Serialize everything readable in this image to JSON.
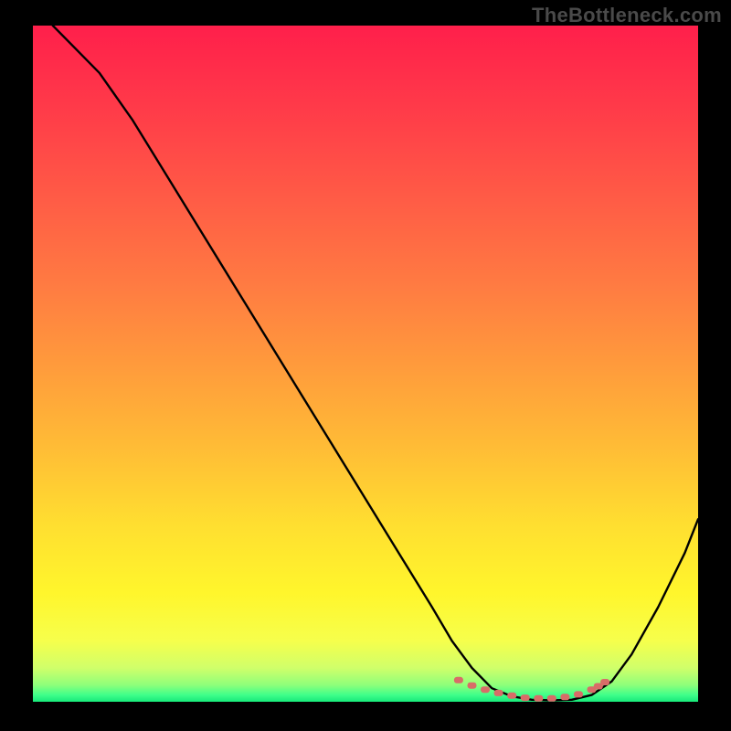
{
  "watermark": "TheBottleneck.com",
  "chart_data": {
    "type": "line",
    "title": "",
    "xlabel": "",
    "ylabel": "",
    "xlim": [
      0,
      100
    ],
    "ylim": [
      0,
      100
    ],
    "grid": false,
    "legend": false,
    "background": "rainbow_vertical",
    "series": [
      {
        "name": "bottleneck-curve",
        "x": [
          3,
          5,
          10,
          15,
          20,
          25,
          30,
          35,
          40,
          45,
          50,
          55,
          60,
          63,
          66,
          69,
          72,
          75,
          78,
          81,
          84,
          87,
          90,
          94,
          98,
          100
        ],
        "y": [
          100,
          98,
          93,
          86,
          78,
          70,
          62,
          54,
          46,
          38,
          30,
          22,
          14,
          9,
          5,
          2,
          0.8,
          0.3,
          0.2,
          0.3,
          1,
          3,
          7,
          14,
          22,
          27
        ]
      }
    ],
    "markers": [
      {
        "name": "highlight-band",
        "x": [
          64,
          66,
          68,
          70,
          72,
          74,
          76,
          78,
          80,
          82,
          84,
          85,
          86
        ],
        "y": [
          3.2,
          2.4,
          1.8,
          1.3,
          0.9,
          0.6,
          0.5,
          0.5,
          0.7,
          1.1,
          1.8,
          2.3,
          2.9
        ]
      }
    ],
    "gradient_stops": [
      {
        "offset": 0.0,
        "color": "#ff1f4b"
      },
      {
        "offset": 0.12,
        "color": "#ff3a49"
      },
      {
        "offset": 0.25,
        "color": "#ff5a46"
      },
      {
        "offset": 0.38,
        "color": "#ff7a42"
      },
      {
        "offset": 0.5,
        "color": "#ff9a3c"
      },
      {
        "offset": 0.62,
        "color": "#ffbb36"
      },
      {
        "offset": 0.74,
        "color": "#ffdf30"
      },
      {
        "offset": 0.84,
        "color": "#fff62c"
      },
      {
        "offset": 0.91,
        "color": "#f6ff4c"
      },
      {
        "offset": 0.95,
        "color": "#d0ff6a"
      },
      {
        "offset": 0.975,
        "color": "#8fff7a"
      },
      {
        "offset": 0.99,
        "color": "#3fff8a"
      },
      {
        "offset": 1.0,
        "color": "#18e87a"
      }
    ]
  }
}
